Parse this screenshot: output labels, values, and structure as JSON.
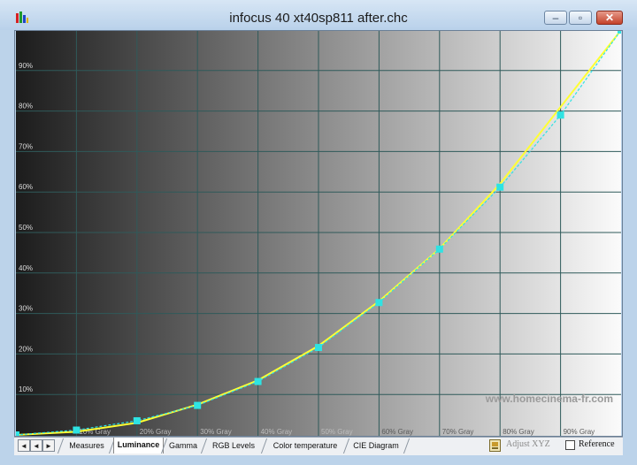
{
  "window": {
    "title": "infocus 40 xt40sp811 after.chc",
    "minimize_label": "–",
    "maximize_label": "▫",
    "close_label": "✕"
  },
  "chart_data": {
    "type": "line",
    "title": "",
    "xlabel": "",
    "ylabel": "",
    "x_categories": [
      "10% Gray",
      "20% Gray",
      "30% Gray",
      "40% Gray",
      "50% Gray",
      "60% Gray",
      "70% Gray",
      "80% Gray",
      "90% Gray"
    ],
    "y_tick_labels": [
      "10%",
      "20%",
      "30%",
      "40%",
      "50%",
      "60%",
      "70%",
      "80%",
      "90%"
    ],
    "ylim": [
      0,
      100
    ],
    "xlim": [
      0,
      100
    ],
    "grid": true,
    "watermark": "www.homecinema-fr.com",
    "series": [
      {
        "color": "#ffff33",
        "marker": "none",
        "x": [
          0,
          10,
          20,
          30,
          40,
          50,
          60,
          70,
          80,
          90,
          100
        ],
        "y": [
          0,
          0.8,
          3,
          7.5,
          13.5,
          22,
          33,
          46,
          62,
          81,
          100
        ]
      },
      {
        "color": "#2ee3e3",
        "marker": "square",
        "x": [
          0,
          10,
          20,
          30,
          40,
          50,
          60,
          70,
          80,
          90,
          100
        ],
        "y": [
          0,
          1.2,
          3.5,
          7.3,
          13.2,
          21.6,
          32.7,
          45.9,
          61.2,
          79,
          100
        ]
      }
    ]
  },
  "tabbar": {
    "nav_first": "◄",
    "nav_prev": "◄",
    "nav_next": "►",
    "tabs": [
      "Measures",
      "Luminance",
      "Gamma",
      "RGB Levels",
      "Color temperature",
      "CIE Diagram"
    ],
    "adjust_label": "Adjust XYZ",
    "reference_label": "Reference"
  }
}
